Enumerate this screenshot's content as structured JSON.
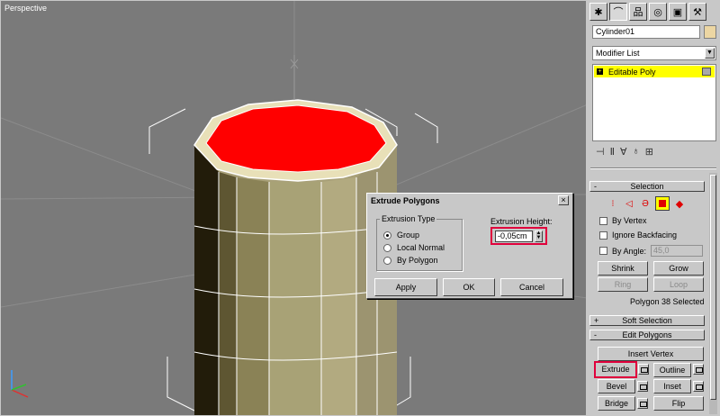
{
  "viewport": {
    "label": "Perspective"
  },
  "dialog": {
    "title": "Extrude Polygons",
    "close": "×",
    "extrusion_type": {
      "legend": "Extrusion Type",
      "options": [
        {
          "label": "Group",
          "selected": true
        },
        {
          "label": "Local Normal",
          "selected": false
        },
        {
          "label": "By Polygon",
          "selected": false
        }
      ]
    },
    "extrusion_height": {
      "label": "Extrusion Height:",
      "value": "-0,05cm"
    },
    "buttons": {
      "apply": "Apply",
      "ok": "OK",
      "cancel": "Cancel"
    }
  },
  "panel": {
    "object_name": "Cylinder01",
    "object_color": "#ecd6a3",
    "modifier_list": "Modifier List",
    "stack": {
      "item": "Editable Poly"
    },
    "selection": {
      "title": "Selection",
      "by_vertex": "By Vertex",
      "ignore_backfacing": "Ignore Backfacing",
      "by_angle": "By Angle:",
      "by_angle_value": "45,0",
      "shrink": "Shrink",
      "grow": "Grow",
      "ring": "Ring",
      "loop": "Loop",
      "status": "Polygon 38 Selected"
    },
    "soft_selection": {
      "title": "Soft Selection"
    },
    "edit_polygons": {
      "title": "Edit Polygons",
      "insert_vertex": "Insert Vertex",
      "extrude": "Extrude",
      "outline": "Outline",
      "bevel": "Bevel",
      "inset": "Inset",
      "bridge": "Bridge",
      "flip": "Flip"
    },
    "rollout_signs": {
      "minus": "-",
      "plus": "+"
    }
  },
  "colors": {
    "selected_face": "#ff0000",
    "highlight": "#e0003c",
    "stack_item": "#ffff00"
  }
}
